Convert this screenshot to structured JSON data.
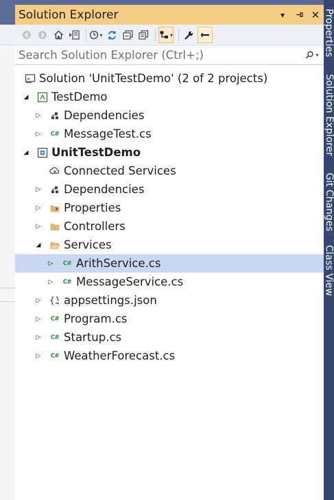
{
  "panel": {
    "title": "Solution Explorer",
    "title_buttons": {
      "dropdown": "▾",
      "pin": "⊣",
      "close": "✕"
    }
  },
  "toolbar": {
    "tools": [
      "back-icon",
      "forward-icon",
      "home-icon",
      "switch-views-icon",
      "pending-changes-filter-icon",
      "sync-icon",
      "collapse-all-icon",
      "show-all-files-icon",
      "preview-selected-icon",
      "properties-icon",
      "pin-icon"
    ]
  },
  "search": {
    "placeholder": "Search Solution Explorer (Ctrl+;)"
  },
  "tree": {
    "solution": "Solution 'UnitTestDemo' (2 of 2 projects)",
    "testdemo": "TestDemo",
    "testdemo_dependencies": "Dependencies",
    "messagetest": "MessageTest.cs",
    "unittestdemo": "UnitTestDemo",
    "connected_services": "Connected Services",
    "dependencies": "Dependencies",
    "properties": "Properties",
    "controllers": "Controllers",
    "services": "Services",
    "arithservice": "ArithService.cs",
    "messageservice": "MessageService.cs",
    "appsettings": "appsettings.json",
    "program": "Program.cs",
    "startup": "Startup.cs",
    "weatherforecast": "WeatherForecast.cs",
    "cs_badge": "C#"
  },
  "side_tabs": [
    "Properties",
    "Solution Explorer",
    "Git Changes",
    "Class View"
  ],
  "colors": {
    "title_active": "#f5cc84",
    "selected_row": "#c9d7f0",
    "frame": "#5d6b99",
    "side_strip": "#364772"
  }
}
